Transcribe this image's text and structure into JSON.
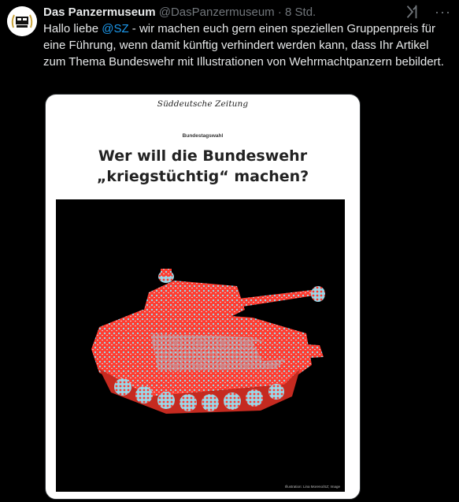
{
  "user": {
    "display_name": "Das Panzermuseum",
    "handle": "@DasPanzermuseum",
    "timestamp": "· 8 Std."
  },
  "tweet": {
    "text_before": "Hallo liebe ",
    "mention": "@SZ",
    "text_after": " - wir machen euch gern einen speziellen Gruppenpreis für eine Führung, wenn damit künftig  verhindert werden kann, dass Ihr Artikel zum Thema Bundeswehr mit Illustrationen von Wehrmachtpanzern bebildert."
  },
  "article": {
    "publication": "Süddeutsche Zeitung",
    "kicker": "Bundestagswahl",
    "headline_line1": "Wer will die Bundeswehr",
    "headline_line2": "„kriegstüchtig“ machen?",
    "image_credit": "Illustration: Lina Moreno/SZ; Image"
  },
  "icons": {
    "grok": "grok-icon",
    "more": "more-options-icon",
    "avatar": "panzermuseum-logo"
  },
  "colors": {
    "mention": "#1d9bf0",
    "tank_red": "#ff3b2f",
    "tank_cyan": "#9ad7e8"
  }
}
